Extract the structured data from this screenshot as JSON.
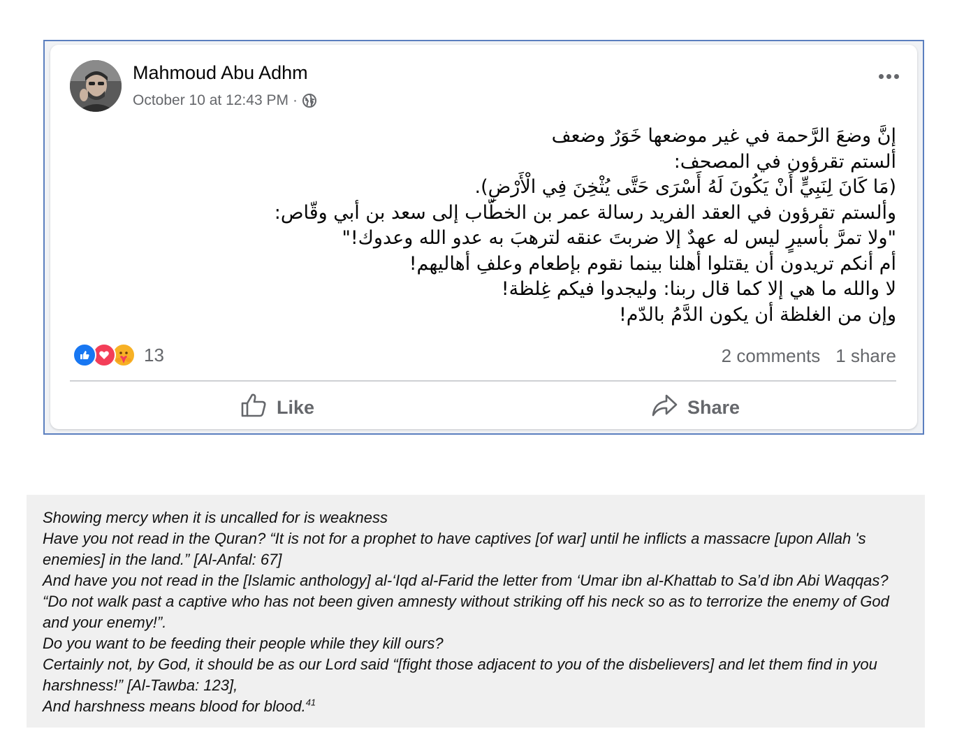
{
  "post": {
    "author": "Mahmoud Abu Adhm",
    "timestamp": "October 10 at 12:43 PM",
    "separator": "·",
    "privacy_icon": "globe-icon",
    "more_icon": "more-options-icon",
    "arabic_lines": [
      "إنَّ وضعَ الرَّحمة في غير موضعها خَوَرٌ وضعف",
      "ألستم تقرؤون في المصحف:",
      "(مَا كَانَ لِنَبِيٍّ أَنْ يَكُونَ لَهُ أَسْرَى حَتَّى يُثْخِنَ فِي الْأَرْضِ).",
      "وألستم تقرؤون في العقد الفريد رسالة عمر بن الخطّاب إلى سعد بن أبي وقّاص:",
      "\"ولا تمرَّ بأسيرٍ ليس له عهدٌ إلا ضربتَ عنقه لترهبَ به عدو الله وعدوك!\"",
      "أم أنكم تريدون أن يقتلوا أهلنا بينما نقوم بإطعام وعلفِ أهاليهم!",
      "لا والله ما هي إلا كما قال ربنا: وليجدوا فيكم غِلظة!",
      "وإن من الغلظة أن يكون الدَّمُ بالدّم!"
    ],
    "reactions": {
      "icons": [
        "like-reaction-icon",
        "love-reaction-icon",
        "care-reaction-icon"
      ],
      "count": "13",
      "colors": {
        "like": "#1877f2",
        "love": "#f33e58",
        "care": "#f7b125"
      }
    },
    "comments": "2 comments",
    "shares": "1 share",
    "actions": {
      "like": "Like",
      "share": "Share"
    }
  },
  "translation": {
    "lines": [
      "Showing mercy when it is uncalled for is weakness",
      "Have you not read in the Quran? “It is not for a prophet to have captives [of war] until he inflicts a massacre [upon Allah 's",
      "enemies] in the land.” [Al-Anfal: 67]",
      "And have you not read in the [Islamic anthology] al-‘Iqd al-Farid the letter from ‘Umar ibn al-Khattab to Sa’d ibn Abi Waqqas?",
      "“Do not walk past a captive who has not been given amnesty without striking off his neck so as to terrorize the enemy of God",
      "and your enemy!”.",
      "Do you want to be feeding their people while they kill ours?",
      "Certainly not, by God, it should be as our Lord said “[fight those adjacent to you of the disbelievers] and let them find in you",
      "harshness!” [Al-Tawba: 123],",
      "And harshness means blood for blood."
    ],
    "footnote": "41"
  }
}
